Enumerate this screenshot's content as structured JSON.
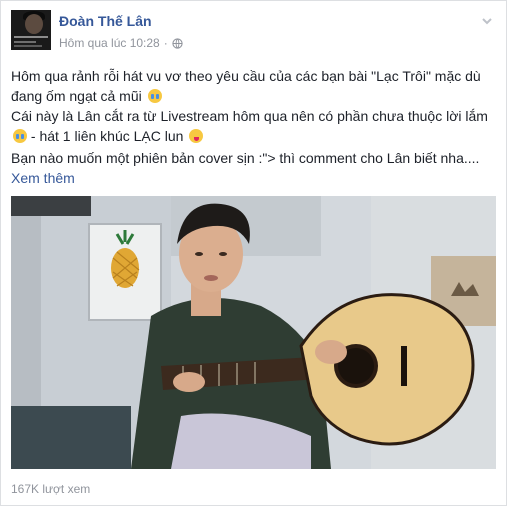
{
  "post": {
    "author": "Đoàn Thế Lân",
    "timestamp": "Hôm qua lúc 10:28",
    "separator": "·",
    "lines": [
      "Hôm qua rảnh rỗi hát vu vơ theo yêu cầu của các bạn bài \"Lạc Trôi\" mặc dù đang ốm ngạt cả mũi",
      "Cái này là Lân cắt ra từ Livestream hôm qua nên có phần chưa thuộc lời lắm",
      " - hát 1 liên khúc LẠC lun",
      "Bạn nào muốn một phiên bản cover sịn :\"> thì comment cho Lân biết nha...."
    ],
    "see_more": "Xem thêm",
    "views": "167K lượt xem"
  },
  "icons": {
    "privacy": "globe-icon",
    "menu": "chevron-down-icon",
    "emoji_1": "crying-face-emoji",
    "emoji_2": "crying-face-emoji",
    "emoji_3": "yum-face-emoji"
  },
  "colors": {
    "link": "#365899",
    "text": "#1d2129",
    "meta": "#90949c"
  }
}
